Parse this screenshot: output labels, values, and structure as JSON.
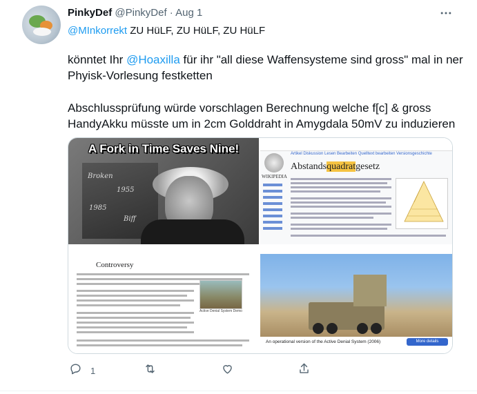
{
  "tweet": {
    "display_name": "PinkyDef",
    "handle": "@PinkyDef",
    "separator": "·",
    "date": "Aug 1",
    "reply_to": "@MInkorrekt",
    "reply_text": " ZU HüLF, ZU HüLF, ZU HüLF",
    "para1_prefix": "könntet Ihr ",
    "para1_mention": "@Hoaxilla",
    "para1_suffix": " für ihr \"all diese Waffensysteme sind gross\" mal in ner",
    "para1_line2": "Phyisk-Vorlesung festketten",
    "para2_line1": "Abschlussprüfung würde vorschlagen Berechnung welche f[c] & gross",
    "para2_line2": "HandyAkku müsste um in 2cm Golddraht in Amygdala 50mV zu induzieren",
    "reply_count": "1"
  },
  "media": {
    "meme_caption": "A Fork in Time Saves Nine!",
    "wiki_title_prefix": "Abstands",
    "wiki_title_highlight": "quadrat",
    "wiki_title_suffix": "gesetz",
    "wiki_logo_text": "WIKIPEDIA",
    "wiki_tabs": "Artikel  Diskussion        Lesen  Bearbeiten  Quelltext bearbeiten  Versionsgeschichte",
    "controversy_heading": "Controversy",
    "photo_caption": "Active Denial System Demo",
    "commons_caption": "An operational version of the Active Denial System (2006)",
    "more_details": "More details"
  },
  "colors": {
    "accent": "#1d9bf0",
    "text": "#0f1419",
    "secondary": "#536471"
  }
}
